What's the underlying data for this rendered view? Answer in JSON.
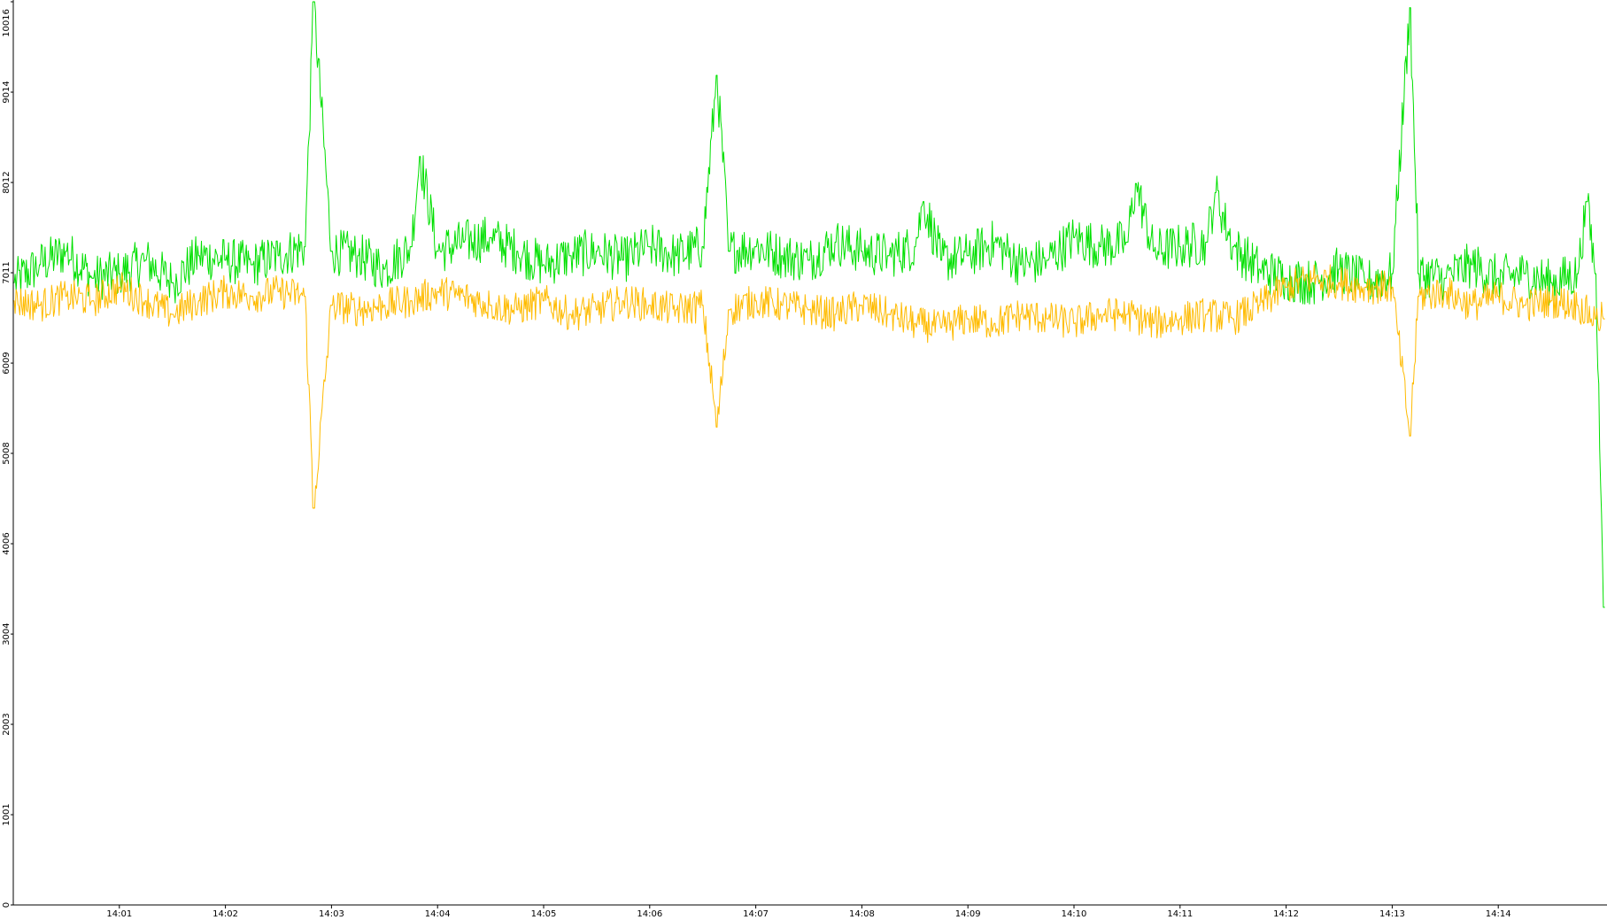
{
  "chart_data": {
    "type": "line",
    "title": "",
    "xlabel": "",
    "ylabel": "",
    "ylim": [
      0,
      10016
    ],
    "xlim": [
      "14:00:00",
      "14:15:00"
    ],
    "y_ticks": [
      "0",
      "1001",
      "2003",
      "3004",
      "4006",
      "5008",
      "6009",
      "7011",
      "8012",
      "9014",
      "10016"
    ],
    "x_ticks": [
      "14:01",
      "14:02",
      "14:03",
      "14:04",
      "14:05",
      "14:06",
      "14:07",
      "14:08",
      "14:09",
      "14:10",
      "14:11",
      "14:12",
      "14:13",
      "14:14"
    ],
    "grid": false,
    "legend": "none",
    "series": [
      {
        "color": "#00e000",
        "x": [
          "14:00:00",
          "14:00:15",
          "14:00:30",
          "14:00:45",
          "14:01:00",
          "14:01:15",
          "14:01:30",
          "14:01:45",
          "14:02:00",
          "14:02:15",
          "14:02:30",
          "14:02:45",
          "14:02:50",
          "14:03:00",
          "14:03:15",
          "14:03:30",
          "14:03:45",
          "14:03:50",
          "14:04:00",
          "14:04:15",
          "14:04:30",
          "14:04:45",
          "14:05:00",
          "14:05:15",
          "14:05:30",
          "14:05:45",
          "14:06:00",
          "14:06:15",
          "14:06:30",
          "14:06:38",
          "14:06:45",
          "14:07:00",
          "14:07:15",
          "14:07:30",
          "14:07:45",
          "14:08:00",
          "14:08:15",
          "14:08:30",
          "14:08:35",
          "14:08:45",
          "14:09:00",
          "14:09:15",
          "14:09:30",
          "14:09:45",
          "14:10:00",
          "14:10:15",
          "14:10:30",
          "14:10:35",
          "14:10:45",
          "14:11:00",
          "14:11:15",
          "14:11:20",
          "14:11:30",
          "14:11:45",
          "14:12:00",
          "14:12:15",
          "14:12:30",
          "14:12:45",
          "14:13:00",
          "14:13:10",
          "14:13:15",
          "14:13:30",
          "14:13:45",
          "14:14:00",
          "14:14:15",
          "14:14:30",
          "14:14:45",
          "14:14:50",
          "14:14:55",
          "14:15:00"
        ],
        "values": [
          6900,
          7100,
          7250,
          6950,
          7000,
          7150,
          6900,
          7200,
          7150,
          7100,
          7200,
          7300,
          10016,
          7250,
          7200,
          7050,
          7300,
          8300,
          7250,
          7350,
          7400,
          7250,
          7100,
          7200,
          7250,
          7150,
          7300,
          7200,
          7300,
          9200,
          7250,
          7300,
          7200,
          7150,
          7350,
          7250,
          7200,
          7300,
          7800,
          7150,
          7200,
          7350,
          7100,
          7150,
          7400,
          7300,
          7350,
          8000,
          7250,
          7300,
          7350,
          7900,
          7300,
          7050,
          6950,
          6900,
          7050,
          6900,
          7000,
          9950,
          7000,
          6950,
          7100,
          6950,
          7000,
          6900,
          7000,
          7800,
          7000,
          3300
        ]
      },
      {
        "color": "#ffbb00",
        "x": [
          "14:00:00",
          "14:00:15",
          "14:00:30",
          "14:00:45",
          "14:01:00",
          "14:01:15",
          "14:01:30",
          "14:01:45",
          "14:02:00",
          "14:02:15",
          "14:02:30",
          "14:02:45",
          "14:02:50",
          "14:03:00",
          "14:03:15",
          "14:03:30",
          "14:03:45",
          "14:04:00",
          "14:04:15",
          "14:04:30",
          "14:04:45",
          "14:05:00",
          "14:05:15",
          "14:05:30",
          "14:05:45",
          "14:06:00",
          "14:06:15",
          "14:06:30",
          "14:06:38",
          "14:06:45",
          "14:07:00",
          "14:07:15",
          "14:07:30",
          "14:07:45",
          "14:08:00",
          "14:08:15",
          "14:08:30",
          "14:08:45",
          "14:09:00",
          "14:09:15",
          "14:09:30",
          "14:09:45",
          "14:10:00",
          "14:10:15",
          "14:10:30",
          "14:10:45",
          "14:11:00",
          "14:11:15",
          "14:11:30",
          "14:11:45",
          "14:12:00",
          "14:12:15",
          "14:12:30",
          "14:12:45",
          "14:13:00",
          "14:13:10",
          "14:13:15",
          "14:13:30",
          "14:13:45",
          "14:14:00",
          "14:14:15",
          "14:14:30",
          "14:14:45",
          "14:14:55",
          "14:15:00"
        ],
        "values": [
          6700,
          6650,
          6750,
          6700,
          6850,
          6700,
          6550,
          6700,
          6800,
          6750,
          6800,
          6750,
          4400,
          6650,
          6600,
          6650,
          6700,
          6800,
          6750,
          6650,
          6600,
          6700,
          6550,
          6600,
          6700,
          6650,
          6600,
          6650,
          5300,
          6600,
          6700,
          6650,
          6600,
          6550,
          6650,
          6550,
          6450,
          6400,
          6500,
          6450,
          6550,
          6500,
          6450,
          6550,
          6550,
          6450,
          6500,
          6550,
          6500,
          6650,
          6850,
          6950,
          6900,
          6850,
          6850,
          5200,
          6750,
          6800,
          6650,
          6750,
          6650,
          6700,
          6650,
          6500,
          6500
        ]
      }
    ]
  }
}
